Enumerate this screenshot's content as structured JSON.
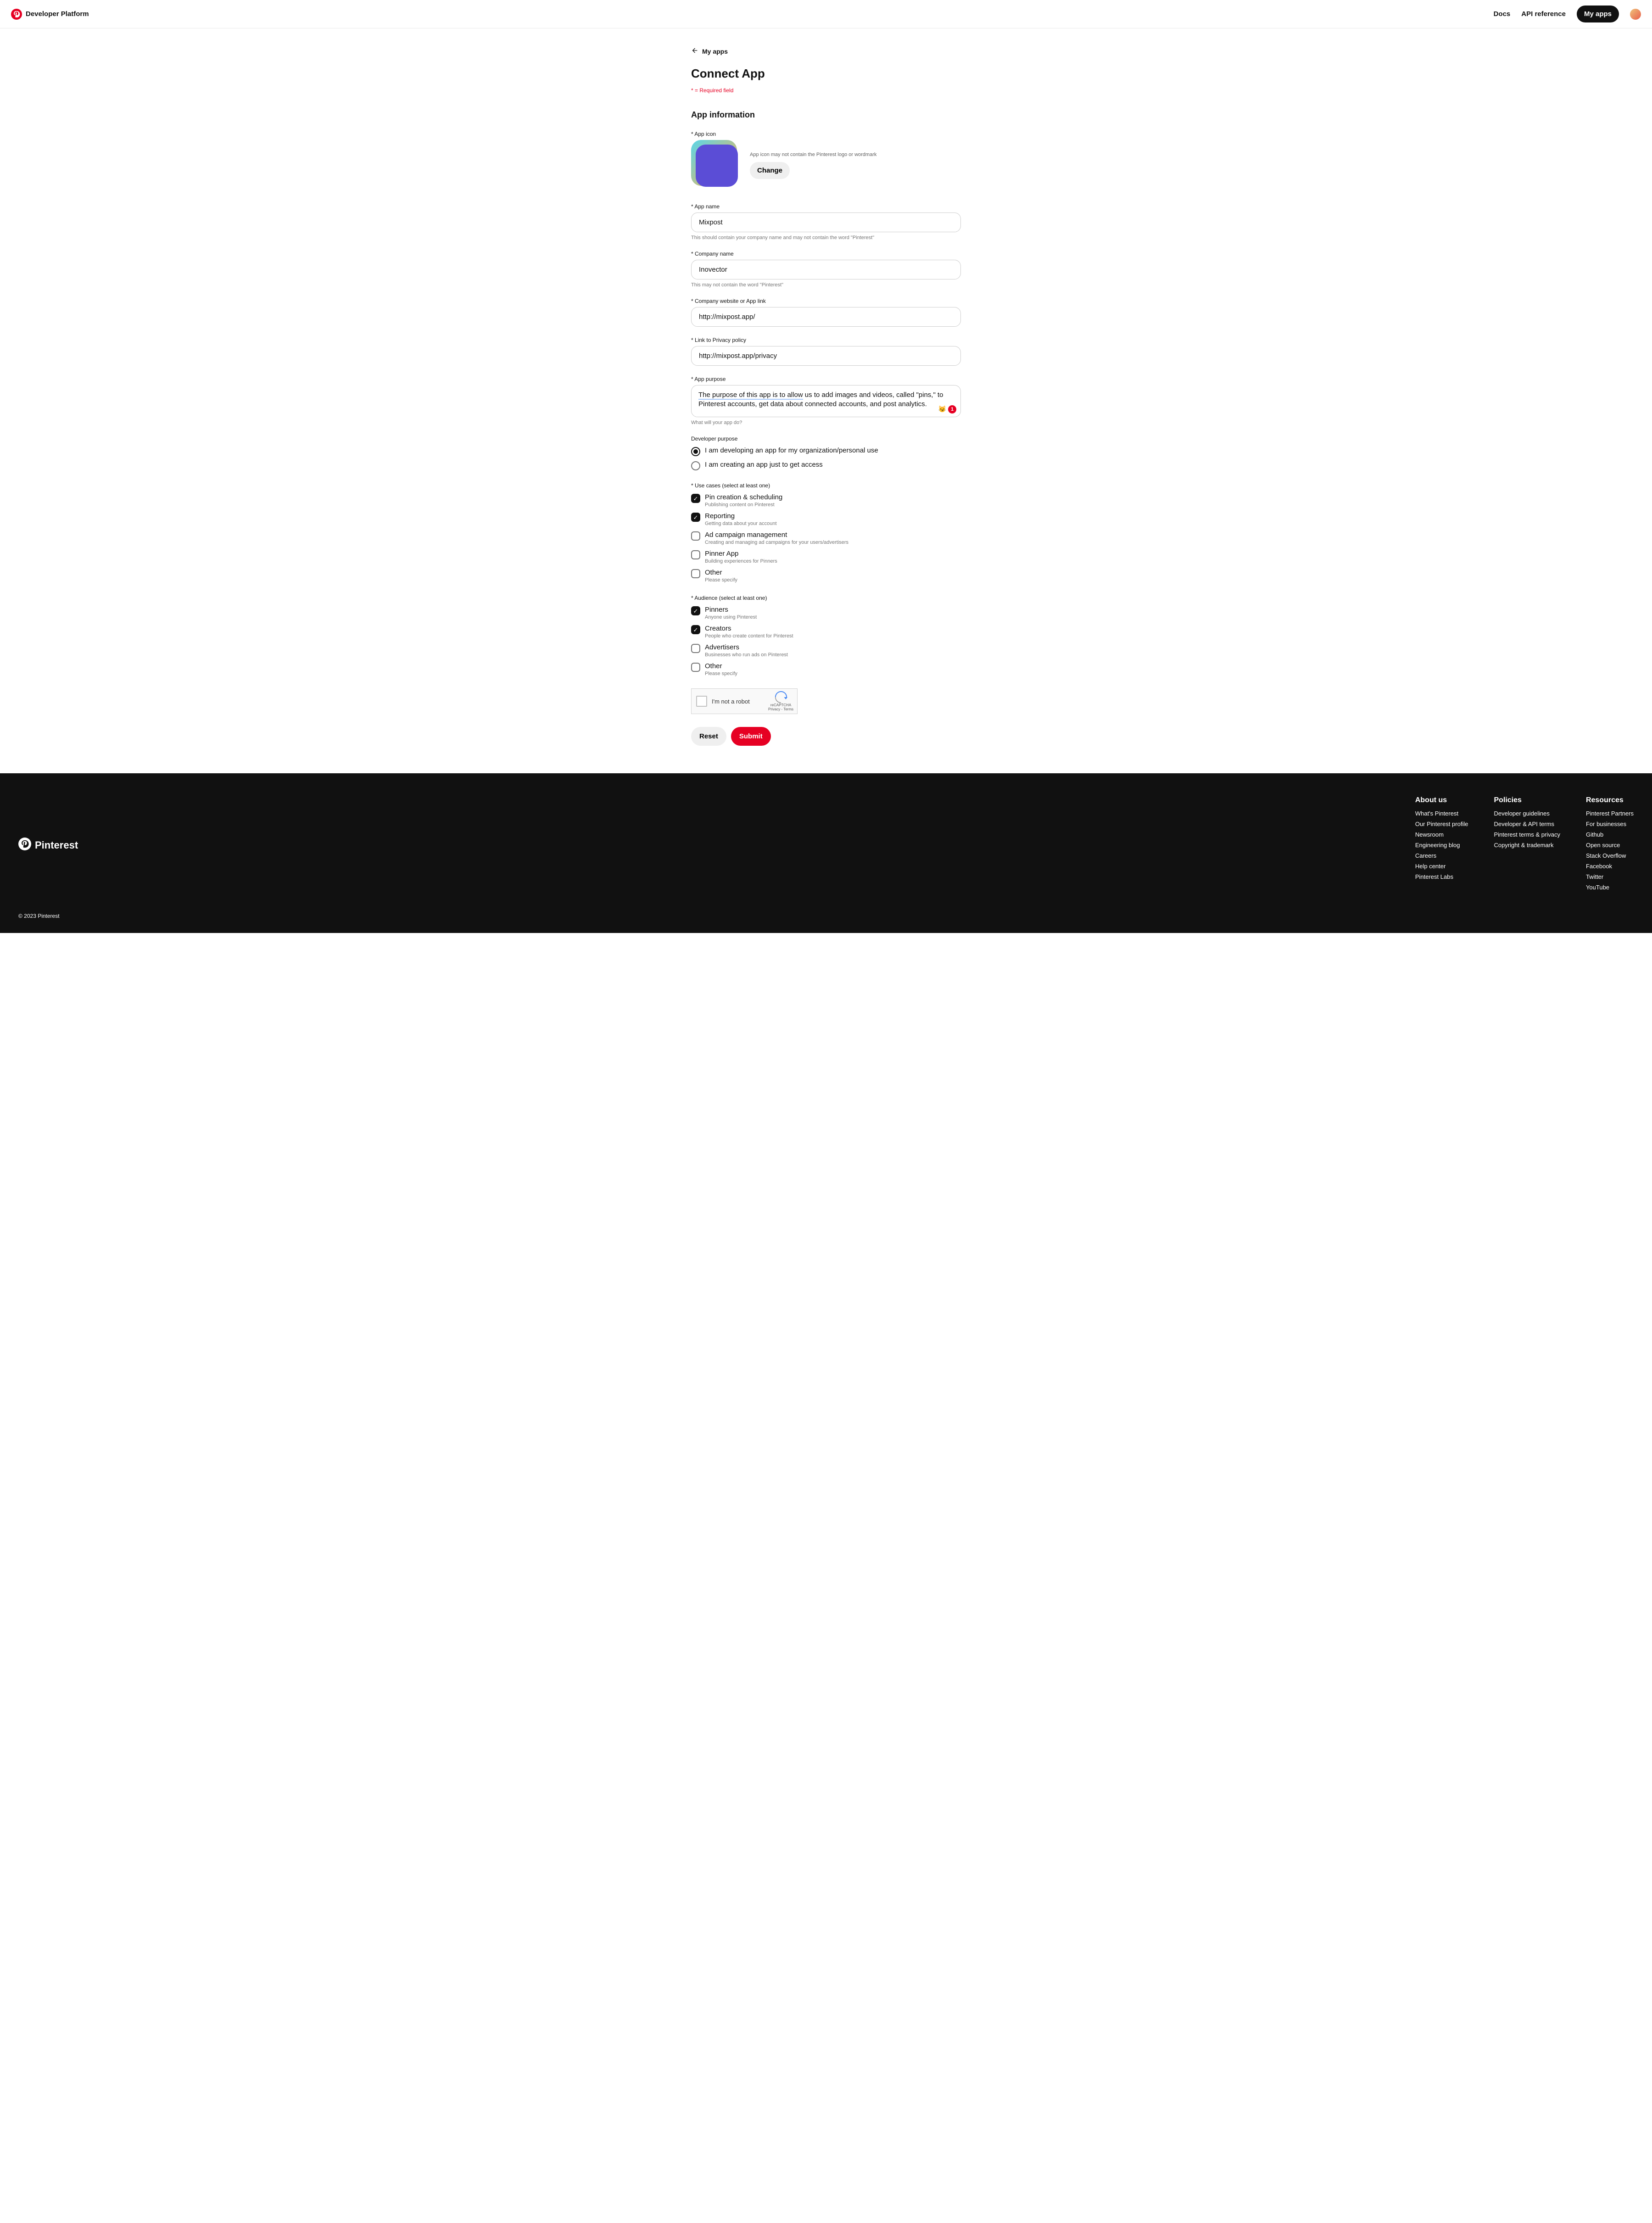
{
  "header": {
    "brand": "Developer Platform",
    "nav": {
      "docs": "Docs",
      "api_ref": "API reference",
      "my_apps": "My apps"
    }
  },
  "page": {
    "back_label": "My apps",
    "title": "Connect App",
    "required_note": "* = Required field",
    "section_app_info": "App information"
  },
  "app_icon": {
    "label": "App icon",
    "note": "App icon may not contain the Pinterest logo or wordmark",
    "change": "Change"
  },
  "fields": {
    "app_name": {
      "label": "App name",
      "value": "Mixpost",
      "helper": "This should contain your company name and may not contain the word \"Pinterest\""
    },
    "company_name": {
      "label": "Company name",
      "value": "Inovector",
      "helper": "This may not contain the word \"Pinterest\""
    },
    "website": {
      "label": "Company website or App link",
      "value": "http://mixpost.app/"
    },
    "privacy": {
      "label": "Link to Privacy policy",
      "value": "http://mixpost.app/privacy"
    },
    "purpose": {
      "label": "App purpose",
      "value_underlined": "The purpose of this app is to allow",
      "value_rest": " us to add images and videos, called \"pins,\" to Pinterest accounts, get data about connected accounts, and post analytics.",
      "helper": "What will your app do?",
      "badge_emoji": "😼",
      "badge_count": "1"
    }
  },
  "developer_purpose": {
    "label": "Developer purpose",
    "options": [
      {
        "label": "I am developing an app for my organization/personal use",
        "checked": true
      },
      {
        "label": "I am creating an app just to get access",
        "checked": false
      }
    ]
  },
  "use_cases": {
    "label": "Use cases (select at least one)",
    "options": [
      {
        "label": "Pin creation & scheduling",
        "desc": "Publishing content on Pinterest",
        "checked": true
      },
      {
        "label": "Reporting",
        "desc": "Getting data about your account",
        "checked": true
      },
      {
        "label": "Ad campaign management",
        "desc": "Creating and managing ad campaigns for your users/advertisers",
        "checked": false
      },
      {
        "label": "Pinner App",
        "desc": "Building experiences for Pinners",
        "checked": false
      },
      {
        "label": "Other",
        "desc": "Please specify",
        "checked": false
      }
    ]
  },
  "audience": {
    "label": "Audience (select at least one)",
    "options": [
      {
        "label": "Pinners",
        "desc": "Anyone using Pinterest",
        "checked": true
      },
      {
        "label": "Creators",
        "desc": "People who create content for Pinterest",
        "checked": true
      },
      {
        "label": "Advertisers",
        "desc": "Businesses who run ads on Pinterest",
        "checked": false
      },
      {
        "label": "Other",
        "desc": "Please specify",
        "checked": false
      }
    ]
  },
  "recaptcha": {
    "label": "I'm not a robot",
    "brand": "reCAPTCHA",
    "terms": "Privacy - Terms"
  },
  "actions": {
    "reset": "Reset",
    "submit": "Submit"
  },
  "footer": {
    "brand": "Pinterest",
    "copyright": "© 2023 Pinterest",
    "cols": [
      {
        "title": "About us",
        "links": [
          "What's Pinterest",
          "Our Pinterest profile",
          "Newsroom",
          "Engineering blog",
          "Careers",
          "Help center",
          "Pinterest Labs"
        ]
      },
      {
        "title": "Policies",
        "links": [
          "Developer guidelines",
          "Developer & API terms",
          "Pinterest terms & privacy",
          "Copyright & trademark"
        ]
      },
      {
        "title": "Resources",
        "links": [
          "Pinterest Partners",
          "For businesses",
          "Github",
          "Open source",
          "Stack Overflow",
          "Facebook",
          "Twitter",
          "YouTube"
        ]
      }
    ]
  }
}
